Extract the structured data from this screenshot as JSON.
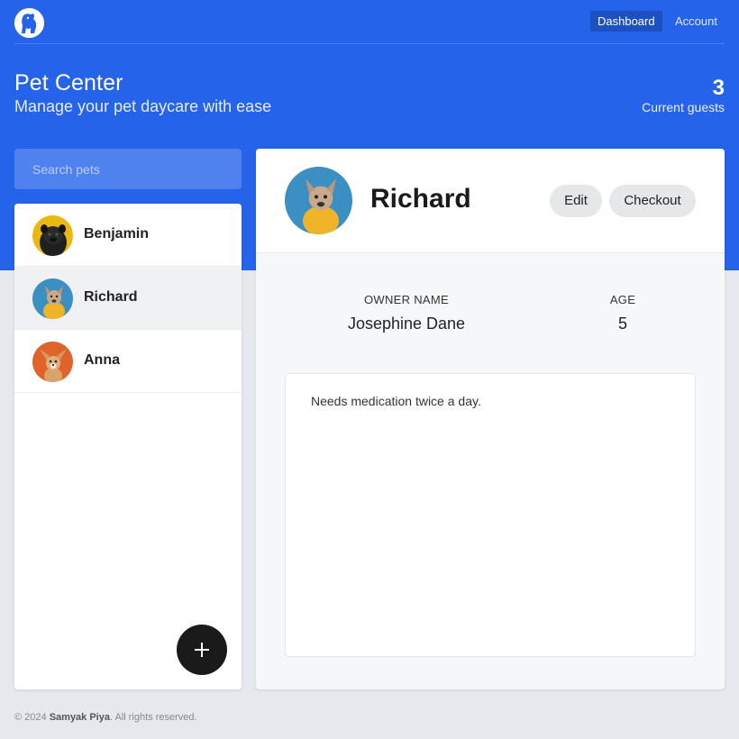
{
  "nav": {
    "logo": "paw-logo-icon",
    "links": [
      {
        "label": "Dashboard",
        "active": true
      },
      {
        "label": "Account",
        "active": false
      }
    ]
  },
  "header": {
    "title": "Pet Center",
    "subtitle": "Manage your pet daycare with ease",
    "guest_count": "3",
    "guest_label": "Current guests"
  },
  "search": {
    "placeholder": "Search pets",
    "value": ""
  },
  "pets": [
    {
      "name": "Benjamin",
      "avatar": "pug-photo",
      "avatar_bg": "#e9b911",
      "selected": false
    },
    {
      "name": "Richard",
      "avatar": "french-bulldog-photo",
      "avatar_bg": "#3b8fc2",
      "selected": true
    },
    {
      "name": "Anna",
      "avatar": "chihuahua-photo",
      "avatar_bg": "#e0632b",
      "selected": false
    }
  ],
  "add_button": {
    "icon": "plus-icon"
  },
  "detail": {
    "name": "Richard",
    "edit_label": "Edit",
    "checkout_label": "Checkout",
    "owner_label": "OWNER NAME",
    "owner_value": "Josephine Dane",
    "age_label": "AGE",
    "age_value": "5",
    "notes": "Needs medication twice a day."
  },
  "footer": {
    "prefix": "© 2024 ",
    "author": "Samyak Piya",
    "suffix": ". All rights reserved."
  },
  "colors": {
    "brand": "#2563eb",
    "page_bg": "#e5e8ec",
    "fab": "#1a1a1a"
  }
}
